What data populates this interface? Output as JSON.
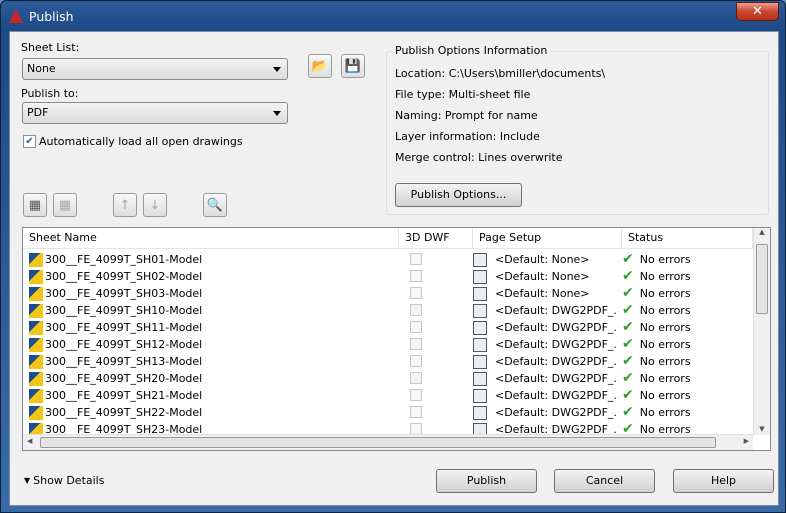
{
  "window": {
    "title": "Publish",
    "close": "✕"
  },
  "sheet_list": {
    "label": "Sheet List:",
    "value": "None"
  },
  "publish_to": {
    "label": "Publish to:",
    "value": "PDF"
  },
  "auto_load": {
    "label": "Automatically load all open drawings",
    "checked": true
  },
  "options_info": {
    "title": "Publish Options Information",
    "lines": [
      "Location: C:\\Users\\bmiller\\documents\\",
      "File type: Multi-sheet file",
      "Naming: Prompt for name",
      "Layer information: Include",
      "Merge control: Lines overwrite"
    ],
    "button": "Publish Options..."
  },
  "table": {
    "columns": [
      "Sheet Name",
      "3D DWF",
      "Page Setup",
      "Status"
    ],
    "rows": [
      {
        "name": "300__FE_4099T_SH01-Model",
        "setup": "<Default: None>",
        "status": "No errors"
      },
      {
        "name": "300__FE_4099T_SH02-Model",
        "setup": "<Default: None>",
        "status": "No errors"
      },
      {
        "name": "300__FE_4099T_SH03-Model",
        "setup": "<Default: None>",
        "status": "No errors"
      },
      {
        "name": "300__FE_4099T_SH10-Model",
        "setup": "<Default: DWG2PDF_...",
        "status": "No errors"
      },
      {
        "name": "300__FE_4099T_SH11-Model",
        "setup": "<Default: DWG2PDF_...",
        "status": "No errors"
      },
      {
        "name": "300__FE_4099T_SH12-Model",
        "setup": "<Default: DWG2PDF_...",
        "status": "No errors"
      },
      {
        "name": "300__FE_4099T_SH13-Model",
        "setup": "<Default: DWG2PDF_...",
        "status": "No errors"
      },
      {
        "name": "300__FE_4099T_SH20-Model",
        "setup": "<Default: DWG2PDF_...",
        "status": "No errors"
      },
      {
        "name": "300__FE_4099T_SH21-Model",
        "setup": "<Default: DWG2PDF_...",
        "status": "No errors"
      },
      {
        "name": "300__FE_4099T_SH22-Model",
        "setup": "<Default: DWG2PDF_...",
        "status": "No errors"
      },
      {
        "name": "300__FE_4099T_SH23-Model",
        "setup": "<Default: DWG2PDF_...",
        "status": "No errors"
      }
    ]
  },
  "footer": {
    "show_details": "Show Details",
    "publish": "Publish",
    "cancel": "Cancel",
    "help": "Help"
  }
}
